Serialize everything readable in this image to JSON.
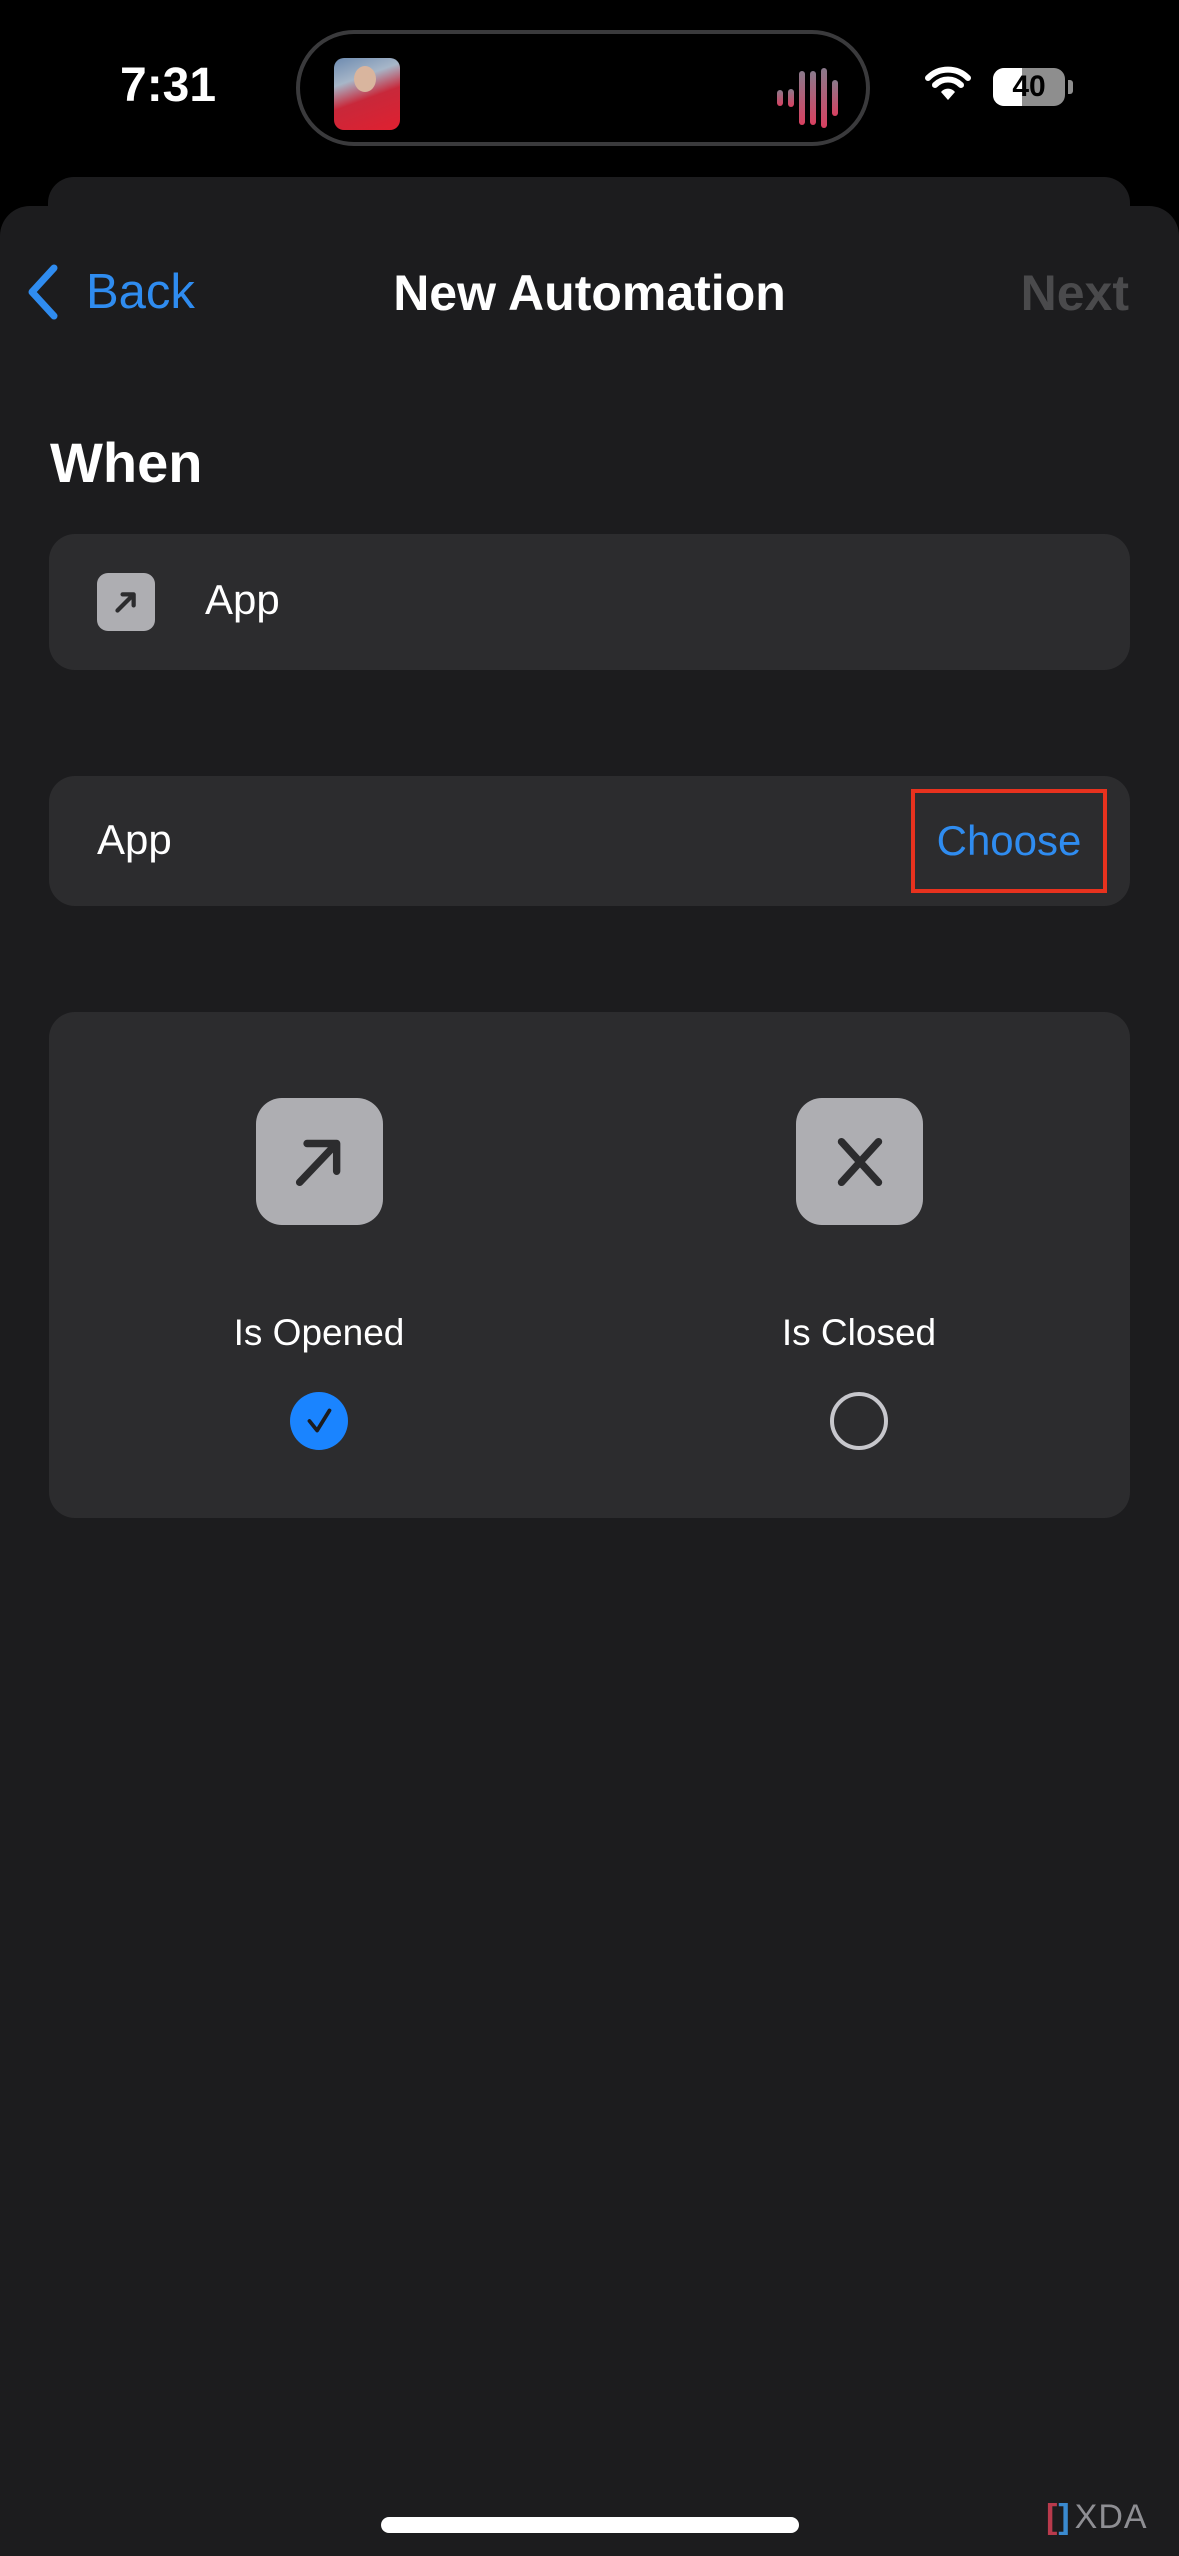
{
  "status_bar": {
    "time": "7:31",
    "battery_level": "40",
    "battery_fraction": 0.4,
    "icons": [
      "now-playing-artwork",
      "audio-waveform-icon",
      "wifi-icon",
      "battery-icon"
    ]
  },
  "nav": {
    "back_label": "Back",
    "title": "New Automation",
    "next_label": "Next"
  },
  "section_title": "When",
  "trigger": {
    "icon": "arrow-up-right-icon",
    "label": "App"
  },
  "app_row": {
    "label": "App",
    "action_label": "Choose"
  },
  "options": [
    {
      "label": "Is Opened",
      "icon": "arrow-up-right-icon",
      "selected": true
    },
    {
      "label": "Is Closed",
      "icon": "x-icon",
      "selected": false
    }
  ],
  "watermark": {
    "text": "XDA"
  },
  "colors": {
    "accent": "#2f8cf0",
    "selected_radio": "#1a84ff",
    "highlight_box": "#e8321e",
    "sheet_bg": "#1c1c1e",
    "card_bg": "#2c2c2e",
    "disabled_text": "#4a4a4c"
  }
}
